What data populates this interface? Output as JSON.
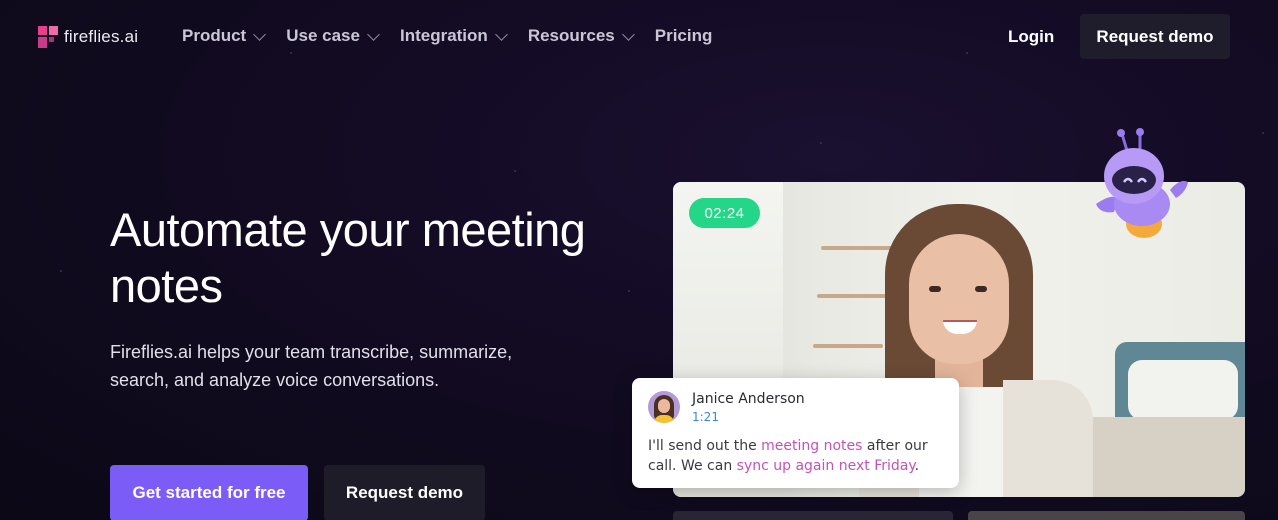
{
  "brand": {
    "name": "fireflies.ai"
  },
  "nav": {
    "items": [
      {
        "label": "Product",
        "has_dropdown": true
      },
      {
        "label": "Use case",
        "has_dropdown": true
      },
      {
        "label": "Integration",
        "has_dropdown": true
      },
      {
        "label": "Resources",
        "has_dropdown": true
      },
      {
        "label": "Pricing",
        "has_dropdown": false
      }
    ],
    "login": "Login",
    "request_demo": "Request demo"
  },
  "hero": {
    "title": "Automate your meeting notes",
    "subtitle": "Fireflies.ai helps your team transcribe, summarize, search, and analyze voice conversations.",
    "cta_primary": "Get started for free",
    "cta_secondary": "Request demo"
  },
  "video": {
    "timer": "02:24"
  },
  "transcript": {
    "speaker": "Janice Anderson",
    "timestamp": "1:21",
    "text_1": "I'll send out the ",
    "highlight_1": "meeting notes",
    "text_2": " after our call. We can ",
    "highlight_2": "sync up again next Friday",
    "text_3": "."
  },
  "colors": {
    "background": "#120b22",
    "primary_button": "#7c5cf6",
    "timer_badge": "#23d688",
    "highlight": "#c253b8",
    "logo": "#e83e8c"
  }
}
